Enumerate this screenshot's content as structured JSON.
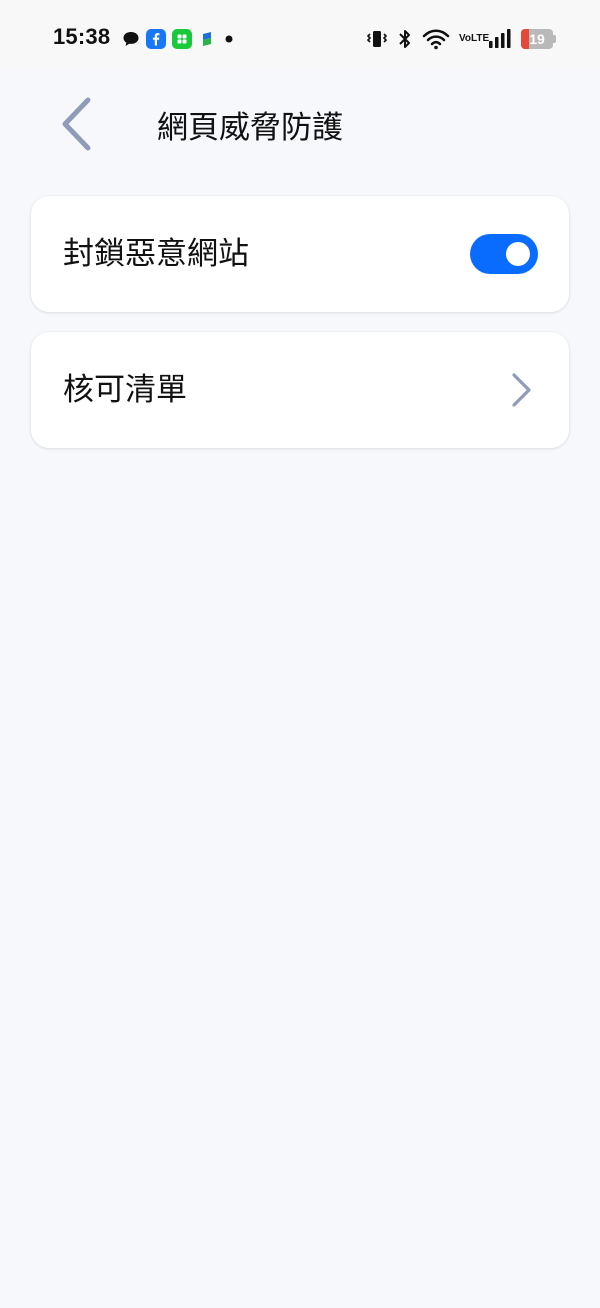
{
  "status_bar": {
    "time": "15:38",
    "battery_level": "19",
    "battery_fraction": 0.19,
    "network_label_top": "Vo",
    "network_label_bottom": "LTE",
    "notification_icons": [
      "chat-bubble-icon",
      "facebook-icon",
      "app-green-icon",
      "app-blue-green-icon",
      "dot-icon"
    ],
    "system_icons": [
      "vibrate-icon",
      "bluetooth-icon",
      "wifi-icon",
      "volte-icon",
      "signal-icon",
      "battery-icon"
    ]
  },
  "header": {
    "title": "網頁威脅防護",
    "back_icon": "chevron-left-icon"
  },
  "settings": {
    "block_malicious_sites": {
      "label": "封鎖惡意網站",
      "enabled": true
    },
    "approved_list": {
      "label": "核可清單",
      "icon": "chevron-right-icon"
    }
  },
  "colors": {
    "accent": "#0a6cff",
    "background": "#f6f8fc",
    "card": "#ffffff",
    "chevron": "#8f9bb8",
    "battery_low": "#e5473b",
    "facebook": "#1877f2",
    "app_green": "#19c93b"
  }
}
